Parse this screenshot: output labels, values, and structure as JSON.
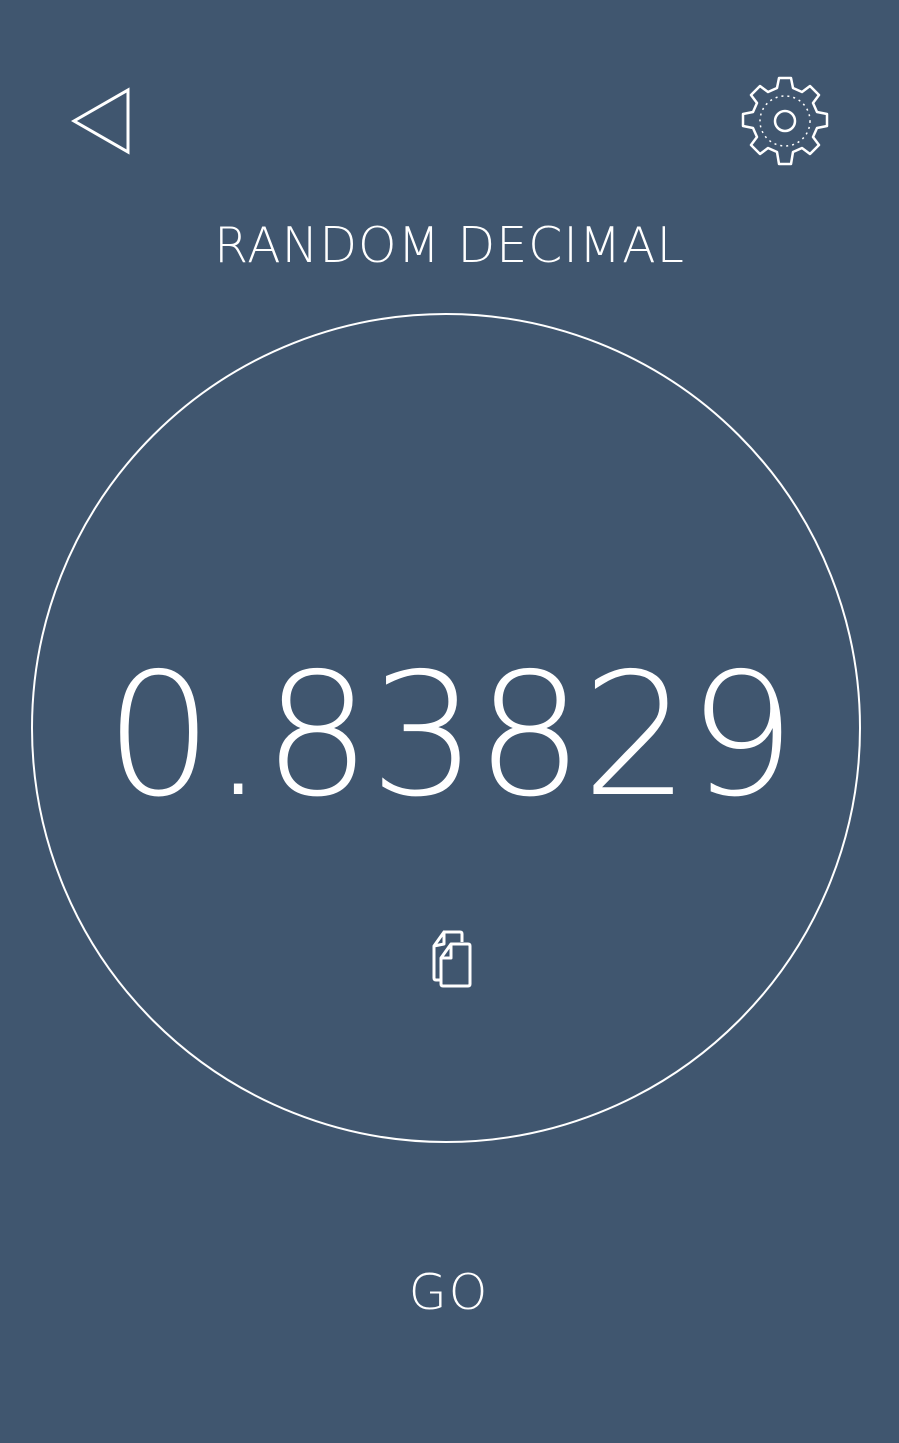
{
  "header": {
    "back_icon": "back-triangle-icon",
    "settings_icon": "gear-icon"
  },
  "title": "RANDOM DECIMAL",
  "result": {
    "value": "0.83829",
    "copy_icon": "copy-icon"
  },
  "actions": {
    "go_label": "GO"
  },
  "colors": {
    "background": "#40566f",
    "foreground": "#ffffff"
  }
}
